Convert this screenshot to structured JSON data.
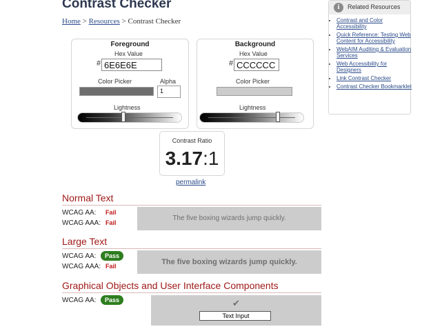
{
  "page": {
    "title": "Contrast Checker"
  },
  "breadcrumb": {
    "home": "Home",
    "sep1": " > ",
    "resources": "Resources",
    "sep2": " > ",
    "current": "Contrast Checker"
  },
  "foreground": {
    "heading": "Foreground",
    "hex_label": "Hex Value",
    "hash": "#",
    "hex_value": "6E6E6E",
    "picker_label": "Color Picker",
    "alpha_label": "Alpha",
    "alpha_value": "1",
    "lightness_label": "Lightness",
    "lightness_level": 0.43,
    "color": "#6e6e6e"
  },
  "background": {
    "heading": "Background",
    "hex_label": "Hex Value",
    "hash": "#",
    "hex_value": "CCCCCC",
    "picker_label": "Color Picker",
    "lightness_label": "Lightness",
    "lightness_level": 0.8,
    "color": "#cccccc"
  },
  "ratio": {
    "label": "Contrast Ratio",
    "value_main": "3.17",
    "value_suffix": ":1",
    "permalink": "permalink"
  },
  "sidebar": {
    "title": "Related Resources",
    "icon": "info-icon",
    "items": [
      "Contrast and Color Accessibility",
      "Quick Reference: Testing Web Content for Accessibility",
      "WebAIM Auditing & Evaluation Services",
      "Web Accessibility for Designers",
      "Link Contrast Checker",
      "Contrast Checker Bookmarklet"
    ]
  },
  "normal_text": {
    "heading": "Normal Text",
    "aa_label": "WCAG AA:",
    "aa_result": "Fail",
    "aaa_label": "WCAG AAA:",
    "aaa_result": "Fail",
    "preview": "The five boxing wizards jump quickly."
  },
  "large_text": {
    "heading": "Large Text",
    "aa_label": "WCAG AA:",
    "aa_result": "Pass",
    "aaa_label": "WCAG AAA:",
    "aaa_result": "Fail",
    "preview": "The five boxing wizards jump quickly."
  },
  "graphical": {
    "heading": "Graphical Objects and User Interface Components",
    "aa_label": "WCAG AA:",
    "aa_result": "Pass",
    "check_icon": "check-icon",
    "input_text": "Text Input"
  },
  "colors": {
    "heading_red": "#a01818",
    "fail_red": "#c01818",
    "pass_green": "#2e7d1f",
    "link_blue": "#2a4a8a"
  }
}
